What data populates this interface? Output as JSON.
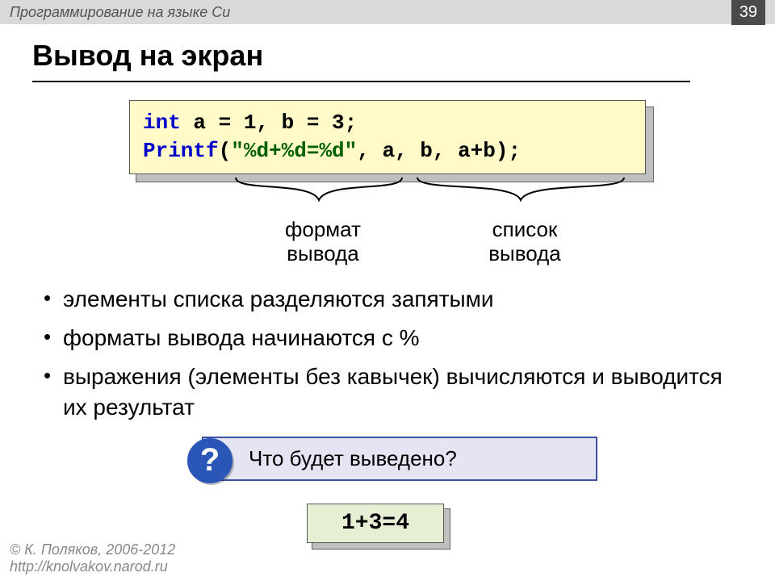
{
  "topbar": {
    "title": "Программирование на языке Си",
    "page": "39"
  },
  "heading": "Вывод на экран",
  "code": {
    "kw_int": "int",
    "decl_rest": " a = 1, b = 3;",
    "kw_printf": "Printf",
    "paren_open": "(",
    "fmt": "\"%d+%d=%d\"",
    "args": ", a, b, a+b);"
  },
  "annot": {
    "format_l1": "формат",
    "format_l2": "вывода",
    "list_l1": "список",
    "list_l2": "вывода"
  },
  "bullets": [
    "элементы списка разделяются запятыми",
    "форматы вывода начинаются с %",
    "выражения (элементы без кавычек) вычисляются и выводится их результат"
  ],
  "question": {
    "mark": "?",
    "text": "Что будет выведено?"
  },
  "answer": "1+3=4",
  "footer": {
    "author": "© К. Поляков, 2006-2012",
    "url": "http://knolvakov.narod.ru"
  }
}
